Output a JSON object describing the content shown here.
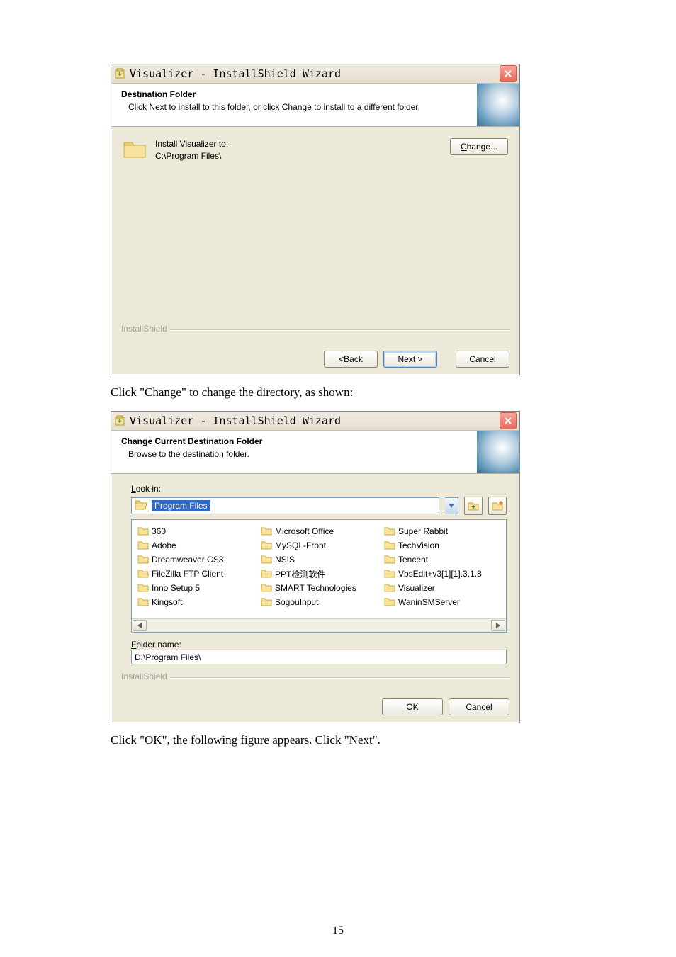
{
  "dialog1": {
    "title": "Visualizer - InstallShield Wizard",
    "header_title": "Destination Folder",
    "header_sub": "Click Next to install to this folder, or click Change to install to a different folder.",
    "install_label": "Install Visualizer to:",
    "install_path": "C:\\Program Files\\",
    "change_btn": "Change...",
    "brand": "InstallShield",
    "back_btn": "< Back",
    "next_btn": "Next >",
    "cancel_btn": "Cancel"
  },
  "caption1": "Click \"Change\" to change the directory, as shown:",
  "dialog2": {
    "title": "Visualizer - InstallShield Wizard",
    "header_title": "Change Current Destination Folder",
    "header_sub": "Browse to the destination folder.",
    "lookin_label": "Look in:",
    "lookin_value": "Program Files",
    "cols": [
      [
        "360",
        "Adobe",
        "Dreamweaver CS3",
        "FileZilla FTP Client",
        "Inno Setup 5",
        "Kingsoft"
      ],
      [
        "Microsoft Office",
        "MySQL-Front",
        "NSIS",
        "PPT检测软件",
        "SMART Technologies",
        "SogouInput"
      ],
      [
        "Super Rabbit",
        "TechVision",
        "Tencent",
        "VbsEdit+v3[1][1].3.1.8",
        "Visualizer",
        "WaninSMServer"
      ]
    ],
    "folder_name_label": "Folder name:",
    "folder_name_value": "D:\\Program Files\\",
    "brand": "InstallShield",
    "ok_btn": "OK",
    "cancel_btn": "Cancel"
  },
  "caption2": "Click \"OK\", the following figure appears. Click \"Next\".",
  "page_number": "15"
}
